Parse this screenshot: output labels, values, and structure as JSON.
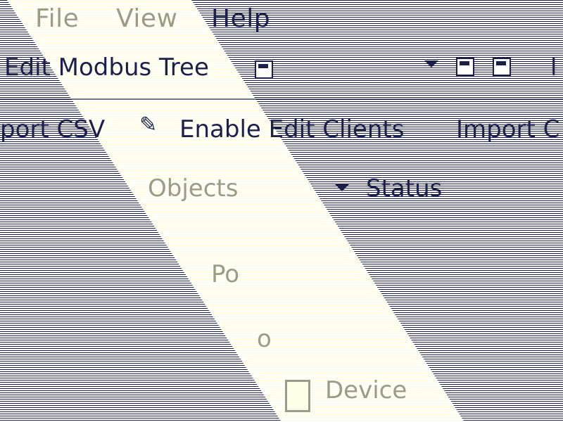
{
  "menu": {
    "file": "File",
    "view": "View",
    "help": "Help"
  },
  "toolbar": {
    "edit_modbus_tree": "Edit Modbus Tree",
    "import_csv_left": "port CSV",
    "enable_edit_clients": "Enable Edit Clients",
    "import_right": "Import C"
  },
  "tree": {
    "objects_header": "Objects",
    "status_header": "Status",
    "item_1": "Po",
    "item_2": "o",
    "item_3": "Device"
  },
  "icons": {
    "tree_icon": "tree-icon",
    "dropdown": "chevron-down-icon",
    "cursor": "cursor-icon",
    "checkbox": "checkbox-icon"
  },
  "colors": {
    "scanline": "#1b1f4a",
    "band": "#fffde0",
    "text": "#1b1f4a"
  }
}
